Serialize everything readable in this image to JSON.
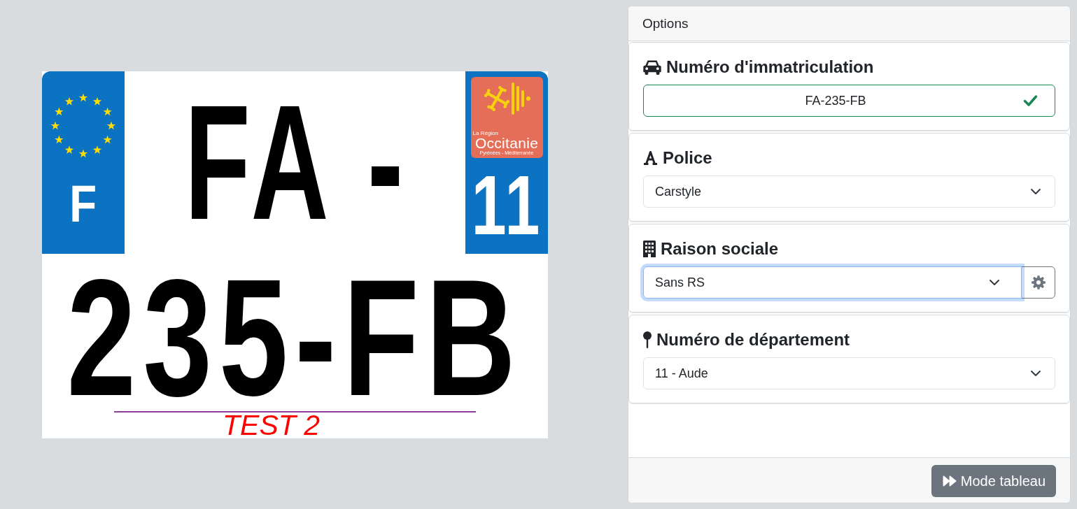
{
  "plate": {
    "country_code": "F",
    "top_line": "FA -",
    "region_logo": [
      "La Région",
      "Occitanie",
      "Pyrénées - Méditerranée"
    ],
    "department_number": "11",
    "bottom_line": "235-FB",
    "caption": "TEST 2"
  },
  "options_panel": {
    "title": "Options",
    "sections": [
      {
        "kind": "text",
        "label": "Numéro d'immatriculation",
        "value": "FA-235-FB",
        "valid": true
      },
      {
        "kind": "select",
        "label": "Police",
        "value": "Carstyle",
        "focused": false,
        "settings_button": false
      },
      {
        "kind": "select",
        "label": "Raison sociale",
        "value": "Sans RS",
        "focused": true,
        "settings_button": true
      },
      {
        "kind": "select",
        "label": "Numéro de département",
        "value": "11 - Aude",
        "focused": false,
        "settings_button": false
      }
    ],
    "footer_button": "Mode tableau"
  }
}
